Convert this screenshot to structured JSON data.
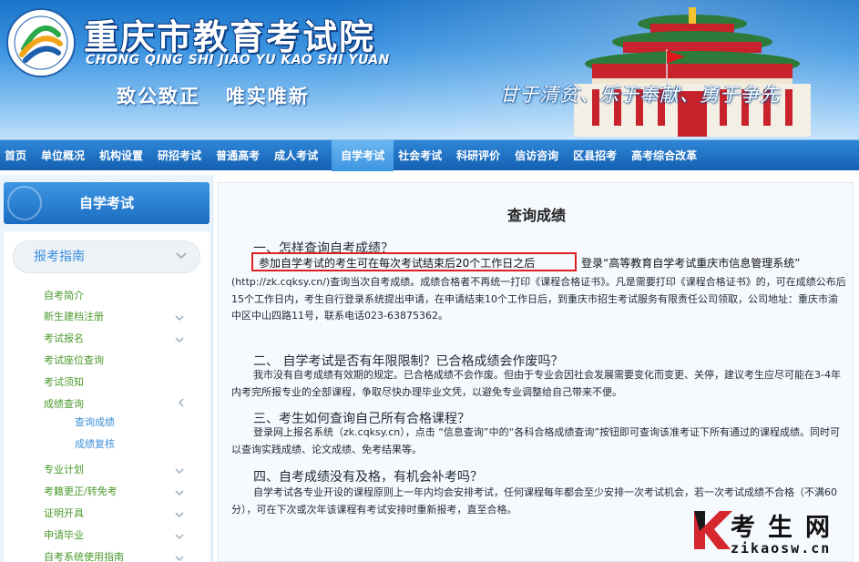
{
  "header": {
    "site_title": "重庆市教育考试院",
    "site_pinyin": "CHONG QING SHI JIAO YU KAO SHI YUAN",
    "motto": "致公致正   唯实唯新",
    "slogan": "甘于清贫、乐于奉献、勇于争先"
  },
  "nav": {
    "items": [
      "首页",
      "单位概况",
      "机构设置",
      "研招考试",
      "普通高考",
      "成人考试",
      "自学考试",
      "社会考试",
      "科研评价",
      "信访咨询",
      "区县招考",
      "高考综合改革"
    ],
    "active": "自学考试"
  },
  "sidebar": {
    "title": "自学考试",
    "guide": "报考指南",
    "items": [
      "自考简介",
      "新生建档注册",
      "考试报名",
      "考试座位查询",
      "考试须知",
      "成绩查询",
      "查询成绩",
      "成绩复核",
      "专业计划",
      "考籍更正/转免考",
      "证明开具",
      "申请毕业",
      "自考系统使用指南"
    ]
  },
  "content": {
    "title": "查询成绩",
    "q1": "一、怎样查询自考成绩？",
    "q1_highlight": "参加自学考试的考生可在每次考试结束后20个工作日之后",
    "q1_after": "登录“高等教育自学考试重庆市信息管理系统”",
    "q1_p2": "(http://zk.cqksy.cn/)查询当次自考成绩。成绩合格者不再统一打印《课程合格证书》。凡是需要打印《课程合格证书》的，可在成绩公布后15个工作日内，考生自行登录系统提出申请，在申请结束10个工作日后，到重庆市招生考试服务有限责任公司领取，公司地址：重庆市渝中区中山四路11号，联系电话023-63875362。",
    "q2": "二、 自学考试是否有年限限制？已合格成绩会作废吗？",
    "q2_p": "我市没有自考成绩有效期的规定。已合格成绩不会作废。但由于专业会因社会发展需要变化而变更、关停，建议考生应尽可能在3-4年内考完所报专业的全部课程，争取尽快办理毕业文凭，以避免专业调整给自己带来不便。",
    "q3": "三、考生如何查询自己所有合格课程？",
    "q3_p": "登录网上报名系统（zk.cqksy.cn），点击 “信息查询”中的“各科合格成绩查询”按钮即可查询该准考证下所有通过的课程成绩。同时可以查询实践成绩、论文成绩、免考结果等。",
    "q4": "四、自考成绩没有及格，有机会补考吗？",
    "q4_p": "自学考试各专业开设的课程原则上一年内均会安排考试，任何课程每年都会至少安排一次考试机会，若一次考试成绩不合格（不满60分），可在下次或次年该课程有考试安排时重新报考，直至合格。"
  },
  "watermark": {
    "name": "考生网",
    "url": "zikaosw.cn"
  },
  "colors": {
    "nav_bg": "#1460b3",
    "nav_active": "#3d95e0",
    "sidebar_item": "#4a9a2c",
    "sidebar_sub": "#3b8fd7",
    "highlight_border": "#e02020"
  },
  "icons": [
    "logo-emblem-icon",
    "chevron-down-icon",
    "chevron-left-icon",
    "k-logo-icon"
  ]
}
